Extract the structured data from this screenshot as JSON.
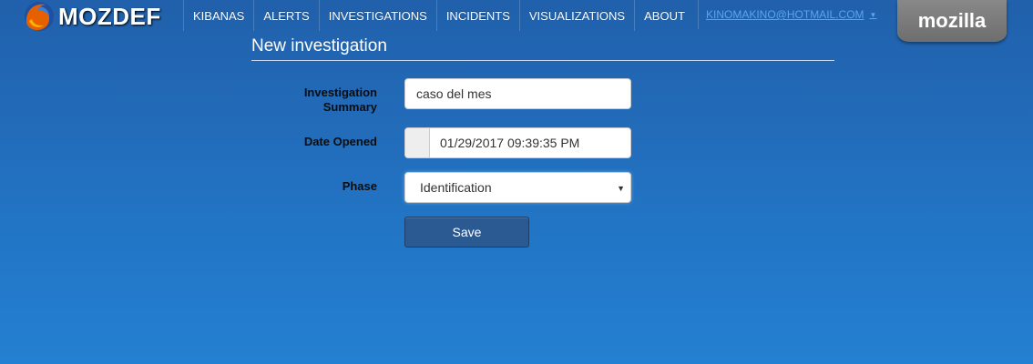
{
  "brand": {
    "name": "MOZDEF",
    "logo_icon": "firefox-logo-icon"
  },
  "nav": {
    "items": [
      "KIBANAS",
      "ALERTS",
      "INVESTIGATIONS",
      "INCIDENTS",
      "VISUALIZATIONS",
      "ABOUT"
    ],
    "user": "KINOMAKINO@HOTMAIL.COM",
    "user_caret": "▼",
    "mozilla": "mozilla"
  },
  "page": {
    "title": "New investigation"
  },
  "form": {
    "summary_label": "Investigation Summary",
    "summary_value": "caso del mes",
    "date_label": "Date Opened",
    "date_value": "01/29/2017 09:39:35 PM",
    "phase_label": "Phase",
    "phase_value": "Identification",
    "save_label": "Save"
  },
  "colors": {
    "background_top": "#2160ab",
    "background_bottom": "#2480d2",
    "button": "#2b5a93",
    "user_link": "#59a4f0"
  }
}
